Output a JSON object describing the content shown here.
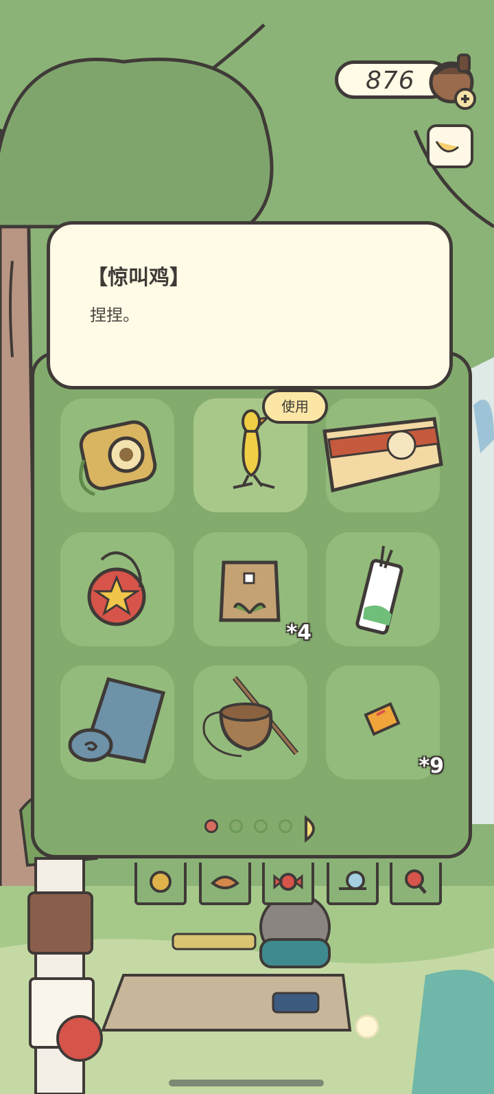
{
  "currency": {
    "label": "876",
    "icon": "acorn-clover-icon",
    "add_icon": "plus-icon"
  },
  "info_card": {
    "title": "【惊叫鸡】",
    "description": "捏捏。"
  },
  "inventory": {
    "use_label": "使用",
    "slots": [
      {
        "item": "instant-camera-icon",
        "qty": ""
      },
      {
        "item": "screaming-chicken-icon",
        "qty": "",
        "selected": true
      },
      {
        "item": "boxed-lunch-icon",
        "qty": ""
      },
      {
        "item": "yoyo-icon",
        "qty": ""
      },
      {
        "item": "seed-bag-icon",
        "qty": "*4"
      },
      {
        "item": "bookmark-charm-icon",
        "qty": ""
      },
      {
        "item": "sleeping-mat-icon",
        "qty": ""
      },
      {
        "item": "fishing-basket-icon",
        "qty": ""
      },
      {
        "item": "ticket-icon",
        "qty": "*9"
      }
    ],
    "pagination": {
      "current": 1,
      "total": 4
    }
  },
  "category_tabs": [
    "food-icon",
    "leaf-bread-icon",
    "candy-icon",
    "snail-icon",
    "magnifier-icon"
  ],
  "colors": {
    "bg_green": "#8bb377",
    "panel_green": "#83ab6d",
    "slot_green": "#93bb7b",
    "cream": "#fffbe6",
    "outline": "#3f3a37",
    "accent_red": "#d66b5f"
  }
}
